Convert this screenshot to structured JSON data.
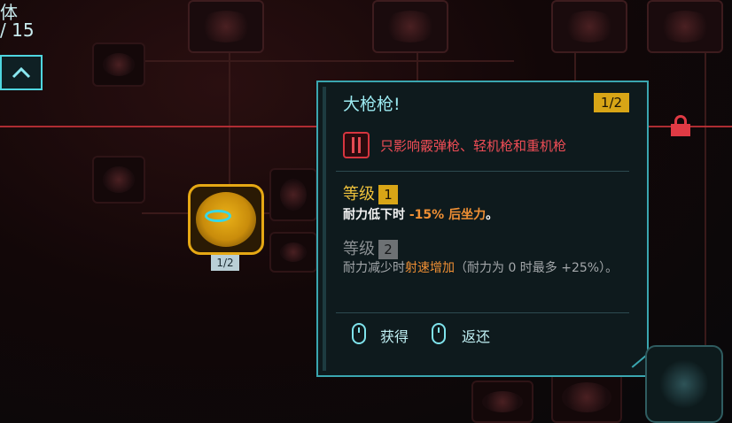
{
  "header": {
    "attribute_label": "体",
    "points": "/ 15"
  },
  "perk": {
    "level_badge": "1/2"
  },
  "tooltip": {
    "title": "大枪枪!",
    "level": "1/2",
    "restriction": "只影响霰弹枪、轻机枪和重机枪",
    "tier1": {
      "label": "等级",
      "num": "1",
      "desc_prefix": "耐力低下时 ",
      "desc_highlight": "-15% 后坐力",
      "desc_suffix": "。"
    },
    "tier2": {
      "label": "等级",
      "num": "2",
      "desc_prefix": "耐力减少时",
      "desc_highlight": "射速增加",
      "desc_suffix": "（耐力为 0 时最多 +25%）。"
    },
    "actions": {
      "acquire": "获得",
      "refund": "返还"
    }
  },
  "colors": {
    "accent_cyan": "#3aa6b0",
    "accent_gold": "#d8a516",
    "warning_red": "#ef4d56",
    "highlight_orange": "#ef8f34"
  }
}
